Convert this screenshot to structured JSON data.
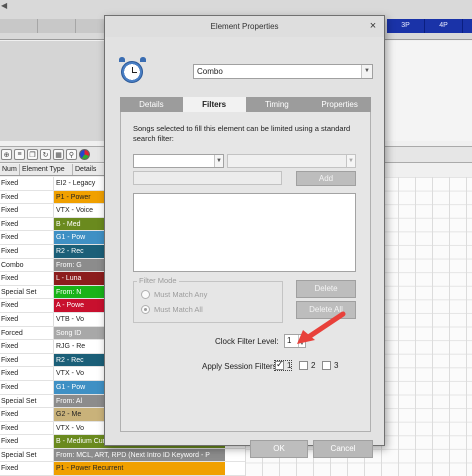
{
  "background": {
    "ruler_left": [
      "",
      "",
      "",
      "",
      "6A",
      "7A",
      ""
    ],
    "ruler_right": [
      "3P",
      "4P",
      "5P"
    ],
    "grid_headers": {
      "num": "Num",
      "type": "Element Type",
      "details": "Details"
    },
    "rows": [
      {
        "type": "Fixed",
        "detail": "EI2 - Legacy",
        "color": "#ffffff",
        "text": "#222"
      },
      {
        "type": "Fixed",
        "detail": "P1 - Power",
        "color": "#f0a000",
        "text": "#222"
      },
      {
        "type": "Fixed",
        "detail": "VTX - Voice",
        "color": "#ffffff",
        "text": "#222"
      },
      {
        "type": "Fixed",
        "detail": "B - Med",
        "color": "#6a8a1e",
        "text": "#fff"
      },
      {
        "type": "Fixed",
        "detail": "G1 - Pow",
        "color": "#3f90c4",
        "text": "#fff"
      },
      {
        "type": "Fixed",
        "detail": "R2 - Rec",
        "color": "#1b5f78",
        "text": "#fff"
      },
      {
        "type": "Combo",
        "detail": "From: G",
        "color": "#8c8c8c",
        "text": "#fff"
      },
      {
        "type": "Fixed",
        "detail": "L - Luna",
        "color": "#8c1d1d",
        "text": "#fff"
      },
      {
        "type": "Special Set",
        "detail": "From: N",
        "color": "#19b319",
        "text": "#fff"
      },
      {
        "type": "Fixed",
        "detail": "A - Powe",
        "color": "#c8102e",
        "text": "#fff"
      },
      {
        "type": "Fixed",
        "detail": "VTB - Vo",
        "color": "#ffffff",
        "text": "#222"
      },
      {
        "type": "Forced",
        "detail": "Song ID",
        "color": "#a8a8a8",
        "text": "#fff"
      },
      {
        "type": "Fixed",
        "detail": "RJG - Re",
        "color": "#ffffff",
        "text": "#222"
      },
      {
        "type": "Fixed",
        "detail": "R2 - Rec",
        "color": "#1b5f78",
        "text": "#fff"
      },
      {
        "type": "Fixed",
        "detail": "VTX - Vo",
        "color": "#ffffff",
        "text": "#222"
      },
      {
        "type": "Fixed",
        "detail": "G1 - Pow",
        "color": "#3f90c4",
        "text": "#fff"
      },
      {
        "type": "Special Set",
        "detail": "From: Al",
        "color": "#8c8c8c",
        "text": "#fff"
      },
      {
        "type": "Fixed",
        "detail": "G2 - Me",
        "color": "#c9b27a",
        "text": "#222"
      },
      {
        "type": "Fixed",
        "detail": "VTX - Vo",
        "color": "#ffffff",
        "text": "#222"
      },
      {
        "type": "Fixed",
        "detail": "B - Medium Current",
        "color": "#6a8a1e",
        "text": "#fff"
      },
      {
        "type": "Special Set",
        "detail": "From: MCL, ART, RPD (Next Intro ID Keyword - P",
        "color": "#8c8c8c",
        "text": "#fff"
      },
      {
        "type": "Fixed",
        "detail": "P1 - Power Recurrent",
        "color": "#f0a000",
        "text": "#222"
      }
    ]
  },
  "dialog": {
    "title": "Element Properties",
    "close_glyph": "×",
    "combo_value": "Combo",
    "tabs": [
      "Details",
      "Filters",
      "Timing",
      "Properties"
    ],
    "active_tab": 1,
    "filters": {
      "description": "Songs selected to fill this element can be limited using a standard search filter:",
      "add_label": "Add",
      "filter_mode_legend": "Filter Mode",
      "match_any": "Must Match Any",
      "match_all": "Must Match All",
      "delete_label": "Delete",
      "delete_all_label": "Delete All",
      "clock_filter_label": "Clock Filter Level:",
      "clock_filter_value": "1",
      "apply_session_label": "Apply Session Filters:",
      "session_options": [
        {
          "label": "1",
          "checked": true
        },
        {
          "label": "2",
          "checked": false
        },
        {
          "label": "3",
          "checked": false
        }
      ]
    },
    "ok_label": "OK",
    "cancel_label": "Cancel",
    "annotation_color": "#e8403a"
  }
}
